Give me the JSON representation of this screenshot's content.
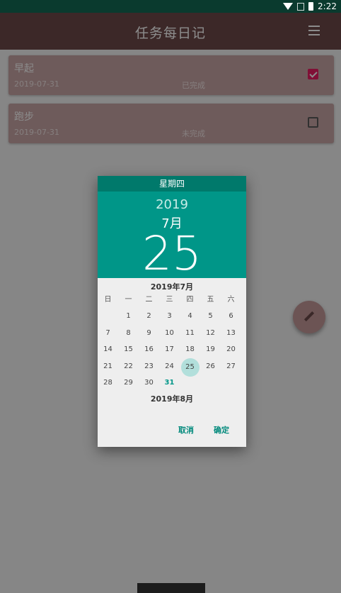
{
  "status": {
    "time": "2:22"
  },
  "toolbar": {
    "title": "任务每日记"
  },
  "tasks": [
    {
      "title": "早起",
      "date": "2019-07-31",
      "status": "已完成",
      "checked": true
    },
    {
      "title": "跑步",
      "date": "2019-07-31",
      "status": "未完成",
      "checked": false
    }
  ],
  "dialog": {
    "weekday": "星期四",
    "year": "2019",
    "month": "7月",
    "day": "25",
    "calendar_title": "2019年7月",
    "weekdays": [
      "日",
      "一",
      "二",
      "三",
      "四",
      "五",
      "六"
    ],
    "leading_blanks": 1,
    "days": [
      "1",
      "2",
      "3",
      "4",
      "5",
      "6",
      "7",
      "8",
      "9",
      "10",
      "11",
      "12",
      "13",
      "14",
      "15",
      "16",
      "17",
      "18",
      "19",
      "20",
      "21",
      "22",
      "23",
      "24",
      "25",
      "26",
      "27",
      "28",
      "29",
      "30",
      "31"
    ],
    "selected_day": "25",
    "today_day": "31",
    "next_month_title": "2019年8月",
    "cancel_label": "取消",
    "ok_label": "确定"
  },
  "colors": {
    "accent": "#009688",
    "toolbar": "#6e4a4a",
    "checked": "#e91e63"
  }
}
